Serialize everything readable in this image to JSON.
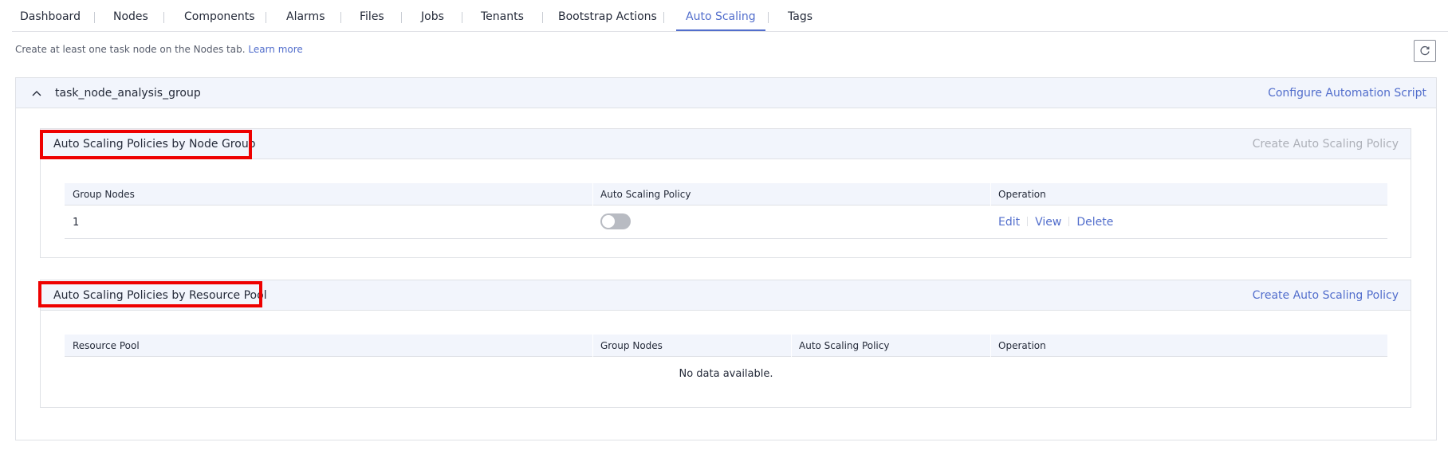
{
  "tabs": [
    {
      "label": "Dashboard"
    },
    {
      "label": "Nodes"
    },
    {
      "label": "Components"
    },
    {
      "label": "Alarms"
    },
    {
      "label": "Files"
    },
    {
      "label": "Jobs"
    },
    {
      "label": "Tenants"
    },
    {
      "label": "Bootstrap Actions"
    },
    {
      "label": "Auto Scaling",
      "active": true
    },
    {
      "label": "Tags"
    }
  ],
  "hint": {
    "text": "Create at least one task node on the Nodes tab.",
    "link": "Learn more"
  },
  "group": {
    "name": "task_node_analysis_group",
    "config_link": "Configure Automation Script"
  },
  "node_group_section": {
    "title": "Auto Scaling Policies by Node Group",
    "create_link": "Create Auto Scaling Policy",
    "columns": [
      "Group Nodes",
      "Auto Scaling Policy",
      "Operation"
    ],
    "rows": [
      {
        "group_nodes": "1",
        "policy_enabled": false,
        "operations": [
          "Edit",
          "View",
          "Delete"
        ]
      }
    ]
  },
  "resource_pool_section": {
    "title": "Auto Scaling Policies by Resource Pool",
    "create_link": "Create Auto Scaling Policy",
    "columns": [
      "Resource Pool",
      "Group Nodes",
      "Auto Scaling Policy",
      "Operation"
    ],
    "empty_text": "No data available."
  },
  "colors": {
    "accent": "#526ecc",
    "highlight_box": "#ee0000",
    "panel_header": "#f2f5fc"
  }
}
